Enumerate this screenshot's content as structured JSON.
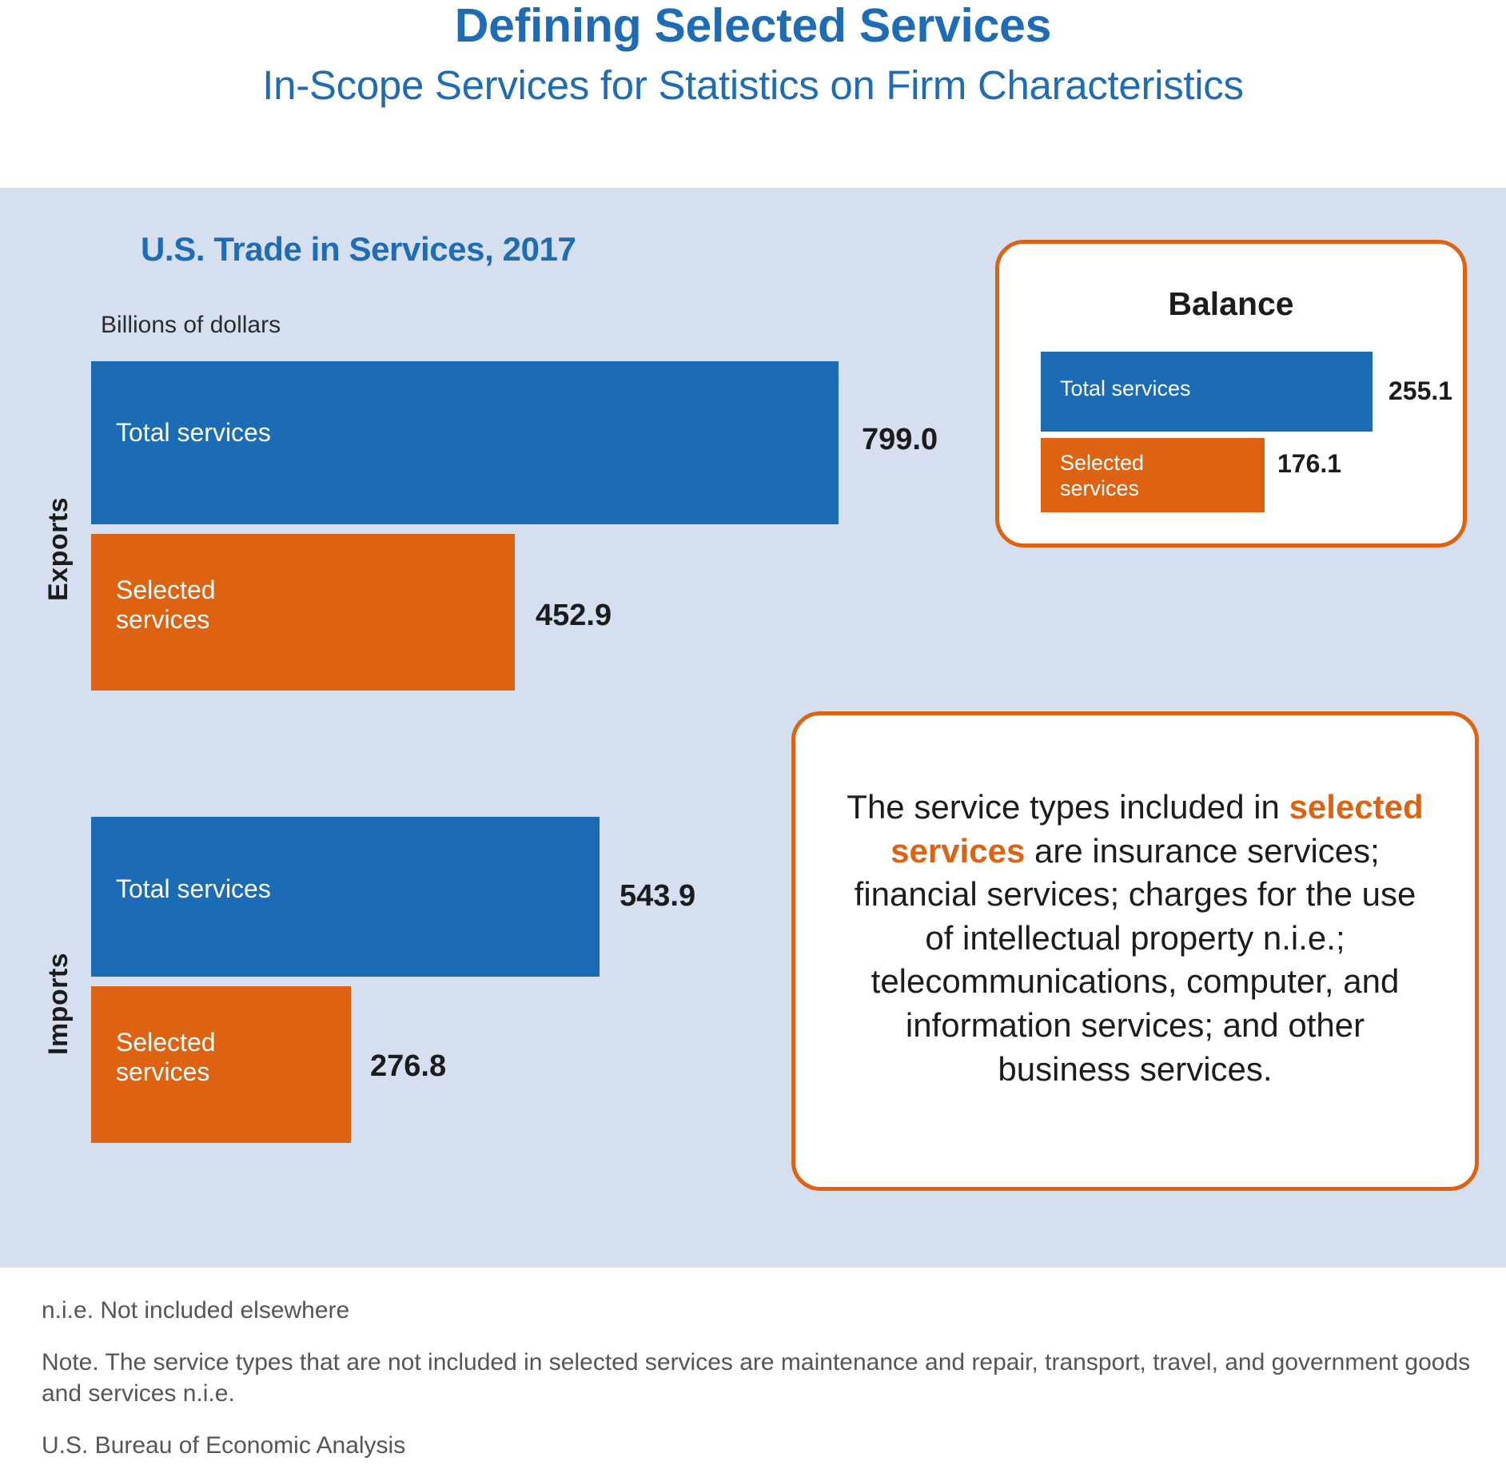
{
  "header": {
    "title": "Defining Selected Services",
    "subtitle": "In-Scope Services for Statistics on Firm Characteristics"
  },
  "chart": {
    "title": "U.S. Trade in Services, 2017",
    "units": "Billions of dollars",
    "group_labels": {
      "exports": "Exports",
      "imports": "Imports"
    },
    "bars": {
      "exports_total": {
        "label": "Total services",
        "value": "799.0"
      },
      "exports_selected": {
        "label": "Selected\nservices",
        "value": "452.9"
      },
      "imports_total": {
        "label": "Total services",
        "value": "543.9"
      },
      "imports_selected": {
        "label": "Selected\nservices",
        "value": "276.8"
      }
    }
  },
  "balance": {
    "title": "Balance",
    "total": {
      "label": "Total services",
      "value": "255.1"
    },
    "selected": {
      "label": "Selected\nservices",
      "value": "176.1"
    }
  },
  "definition": {
    "lead": "The service types included in ",
    "highlight": "selected services",
    "rest": " are insurance services; financial services; charges for the use of intellectual property n.i.e.; telecommunications, computer, and information services; and other business services."
  },
  "footnotes": {
    "abbreviation": "n.i.e. Not included elsewhere",
    "note": "Note. The service types that are not included in selected services are maintenance and repair, transport, travel, and government goods and services n.i.e.",
    "source": "U.S. Bureau of Economic Analysis"
  },
  "colors": {
    "brand_blue": "#1d6cb5",
    "bar_blue": "#1b6cb5",
    "bar_orange": "#dd6312",
    "panel_bg": "#d5dff0",
    "footnote_gray": "#555555"
  },
  "chart_data": {
    "type": "bar",
    "title": "U.S. Trade in Services, 2017",
    "subtitle": "Billions of dollars",
    "xlabel": "Billions of dollars",
    "ylabel": "",
    "orientation": "horizontal",
    "grid": false,
    "legend": "none",
    "xlim": [
      0,
      799.0
    ],
    "groups": [
      "Exports",
      "Imports"
    ],
    "categories": [
      "Total services",
      "Selected services"
    ],
    "series": [
      {
        "name": "Total services",
        "values": [
          799.0,
          543.9
        ],
        "color": "#1b6cb5"
      },
      {
        "name": "Selected services",
        "values": [
          452.9,
          276.8
        ],
        "color": "#dd6312"
      }
    ],
    "inset_chart": {
      "type": "bar",
      "title": "Balance",
      "orientation": "horizontal",
      "categories": [
        "Total services",
        "Selected services"
      ],
      "values": [
        255.1,
        176.1
      ],
      "colors": [
        "#1b6cb5",
        "#dd6312"
      ]
    }
  }
}
